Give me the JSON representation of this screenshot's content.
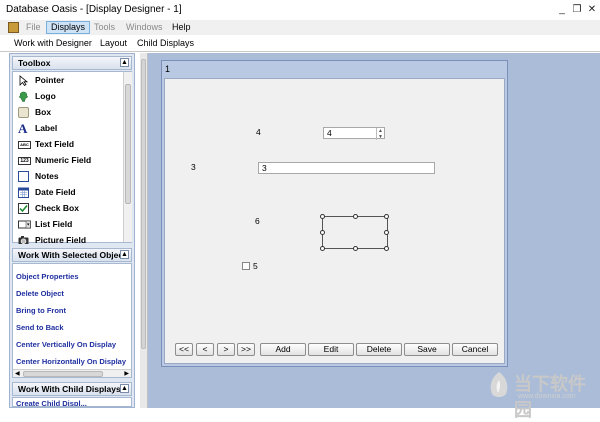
{
  "window": {
    "title": "Database Oasis - [Display Designer - 1]",
    "controls": [
      "_",
      "❐",
      "✕"
    ]
  },
  "menu": {
    "file": "File",
    "displays": "Displays",
    "tools": "Tools",
    "windows": "Windows",
    "help": "Help"
  },
  "subtoolbar": {
    "work_with_designer": "Work with Designer",
    "layout": "Layout",
    "child_displays": "Child Displays"
  },
  "toolbox": {
    "title": "Toolbox",
    "items": [
      {
        "label": "Pointer",
        "icon": "pointer-icon"
      },
      {
        "label": "Logo",
        "icon": "logo-icon"
      },
      {
        "label": "Box",
        "icon": "box-icon"
      },
      {
        "label": "Label",
        "icon": "label-icon"
      },
      {
        "label": "Text Field",
        "icon": "text-field-icon"
      },
      {
        "label": "Numeric Field",
        "icon": "numeric-field-icon"
      },
      {
        "label": "Notes",
        "icon": "notes-icon"
      },
      {
        "label": "Date Field",
        "icon": "date-field-icon"
      },
      {
        "label": "Check Box",
        "icon": "check-box-icon"
      },
      {
        "label": "List Field",
        "icon": "list-field-icon"
      },
      {
        "label": "Picture Field",
        "icon": "picture-field-icon"
      }
    ]
  },
  "selected_panel": {
    "title": "Work With Selected Objec",
    "links": [
      "Object Properties",
      "Delete Object",
      "Bring to Front",
      "Send to Back",
      "Center Vertically On Display",
      "Center Horizontally On Display"
    ]
  },
  "child_panel": {
    "title": "Work With Child Displays",
    "partial": "Create Child Displ..."
  },
  "designer": {
    "caption": "1",
    "labels": {
      "l4": "4",
      "l3": "3",
      "l6": "6",
      "l5": "5"
    },
    "fields": {
      "f4": "4",
      "f3": "3"
    },
    "nav": {
      "first": "<<",
      "prev": "<",
      "next": ">",
      "last": ">>",
      "add": "Add",
      "edit": "Edit",
      "delete": "Delete",
      "save": "Save",
      "cancel": "Cancel"
    }
  },
  "watermark": {
    "brand": "当下软件园",
    "url": "www.downxia.com"
  }
}
